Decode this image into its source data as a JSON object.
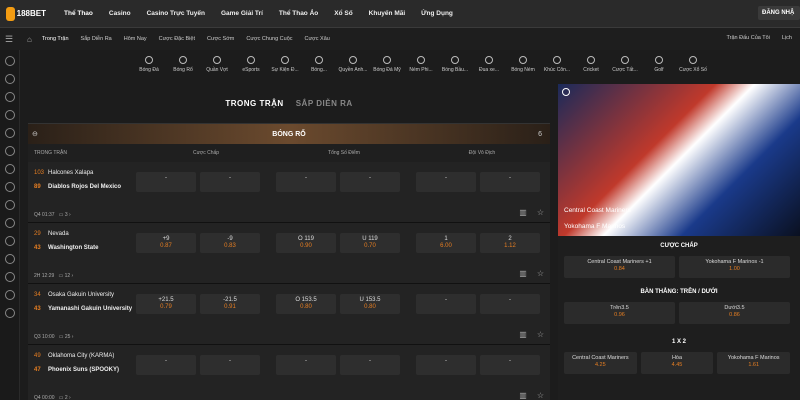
{
  "brand": {
    "logo_text": "188BET",
    "login_label": "ĐĂNG NHẬ"
  },
  "topnav": [
    "Thể Thao",
    "Casino",
    "Casino Trực Tuyến",
    "Game Giải Trí",
    "Thể Thao Ảo",
    "Xổ Số",
    "Khuyến Mãi",
    "Ứng Dụng"
  ],
  "subnav": [
    "Trong Trận",
    "Sắp Diễn Ra",
    "Hôm Nay",
    "Cược Đặc Biệt",
    "Cược Sớm",
    "Cược Chung Cuộc",
    "Cược Xâu"
  ],
  "subright": [
    "Trận Đấu Của Tôi",
    "Lịch"
  ],
  "sports": [
    "Bóng Đá",
    "Bóng Rổ",
    "Quần Vợt",
    "eSports",
    "Sự Kiện Đ...",
    "Bóng...",
    "Quyền Anh...",
    "Bóng Đá Mỹ",
    "Ném Phi...",
    "Bóng Bầu...",
    "Đua xe...",
    "Bóng Ném",
    "Khúc Côn...",
    "Cricket",
    "Cược Tất...",
    "Golf",
    "Cược Xổ Số"
  ],
  "tabs": {
    "live": "TRONG TRẬN",
    "upcoming": "SẮP DIỄN RA"
  },
  "section": {
    "title": "BÓNG RỔ",
    "count": "6"
  },
  "columns": {
    "c0": "TRONG TRẬN",
    "c1": "Cược Chấp",
    "c2": "Tổng Số Điểm",
    "c3": "Đội Vô Địch"
  },
  "matches": [
    {
      "s1": "103",
      "t1": "Halcones Xalapa",
      "s2": "89",
      "t2": "Diablos Rojos Del Mexico",
      "foot": "Q4 01:37",
      "more": "3 ›",
      "h1": "-",
      "h2": "-",
      "g1": "-",
      "g2": "-",
      "w1": "-",
      "w2": "-",
      "h1o": "",
      "h2o": "",
      "g1o": "",
      "g2o": "",
      "w1o": "",
      "w2o": ""
    },
    {
      "s1": "29",
      "t1": "Nevada",
      "s2": "43",
      "t2": "Washington State",
      "foot": "2H 12:29",
      "more": "12 ›",
      "h1": "+9",
      "h1o": "0.87",
      "h2": "-9",
      "h2o": "0.83",
      "g1": "O 119",
      "g1o": "0.90",
      "g2": "U 119",
      "g2o": "0.70",
      "w1": "1",
      "w1o": "6.00",
      "w2": "2",
      "w2o": "1.12"
    },
    {
      "s1": "34",
      "t1": "Osaka Gakuin University",
      "s2": "43",
      "t2": "Yamanashi Gakuin University",
      "foot": "Q3 10:00",
      "more": "25 ›",
      "h1": "+21.5",
      "h1o": "0.79",
      "h2": "-21.5",
      "h2o": "0.91",
      "g1": "O 153.5",
      "g1o": "0.80",
      "g2": "U 153.5",
      "g2o": "0.80",
      "w1": "-",
      "w1o": "",
      "w2": "-",
      "w2o": ""
    },
    {
      "s1": "49",
      "t1": "Oklahoma City (KARMA)",
      "s2": "47",
      "t2": "Phoenix Suns (SPOOKY)",
      "foot": "Q4 00:00",
      "more": "2 ›",
      "h1": "-",
      "h2": "-",
      "g1": "-",
      "g2": "-",
      "w1": "-",
      "w2": "-",
      "h1o": "",
      "h2o": "",
      "g1o": "",
      "g2o": "",
      "w1o": "",
      "w2o": ""
    }
  ],
  "right": {
    "team1": "Central Coast Mariners",
    "team2": "Yokohama F Marinos",
    "hcp_title": "CƯỢC CHẤP",
    "hcp": [
      {
        "label": "Central Coast Mariners +1",
        "odds": "0.84"
      },
      {
        "label": "Yokohama F Marinos -1",
        "odds": "1.00"
      }
    ],
    "ou_title": "BÀN THẮNG: TRÊN / DƯỚI",
    "ou": [
      {
        "label": "Trên3.5",
        "odds": "0.96"
      },
      {
        "label": "Dưới3.5",
        "odds": "0.86"
      }
    ],
    "x12_title": "1 X 2",
    "x12": [
      {
        "label": "Central Coast Mariners",
        "odds": "4.25"
      },
      {
        "label": "Hòa",
        "odds": "4.45"
      },
      {
        "label": "Yokohama F Marinos",
        "odds": "1.61"
      }
    ]
  },
  "colors": {
    "accent": "#e67e22",
    "bg": "#1c1c1c",
    "topbar": "#2a2a2a"
  }
}
